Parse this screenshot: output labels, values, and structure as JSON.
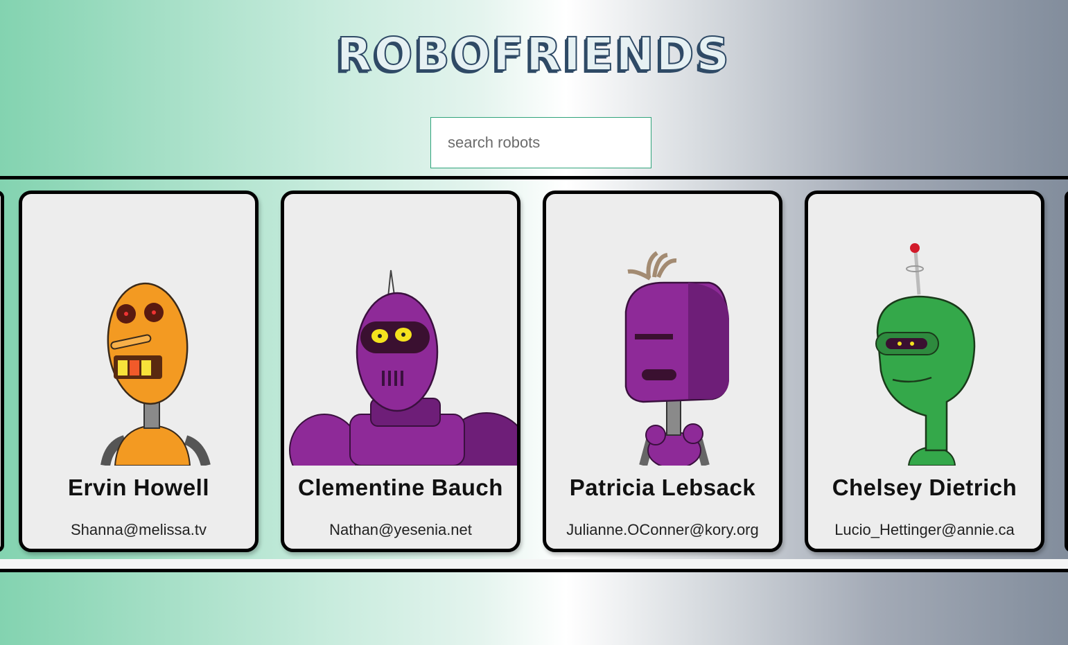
{
  "app": {
    "title": "ROBOFRIENDS"
  },
  "search": {
    "placeholder": "search robots",
    "value": ""
  },
  "robots": [
    {
      "name": "Ervin Howell",
      "email": "Shanna@melissa.tv",
      "color": "#f39a22"
    },
    {
      "name": "Clementine Bauch",
      "email": "Nathan@yesenia.net",
      "color": "#8e2a98"
    },
    {
      "name": "Patricia Lebsack",
      "email": "Julianne.OConner@kory.org",
      "color": "#8e2a98"
    },
    {
      "name": "Chelsey Dietrich",
      "email": "Lucio_Hettinger@annie.ca",
      "color": "#34a84a"
    }
  ]
}
